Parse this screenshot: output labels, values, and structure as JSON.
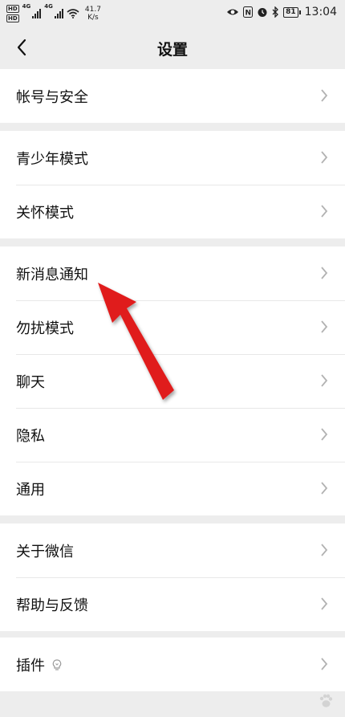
{
  "status_bar": {
    "sim1_label": "HD",
    "sim2_label": "HD",
    "net_type_1": "4G",
    "net_type_2": "4G",
    "speed_value": "41.7",
    "speed_unit": "K/s",
    "battery_level": "81",
    "time": "13:04",
    "icons": [
      "eye-icon",
      "nfc-icon",
      "alarm-icon",
      "bluetooth-icon",
      "battery-icon"
    ]
  },
  "nav": {
    "title": "设置",
    "back_icon": "chevron-left-icon"
  },
  "groups": [
    {
      "items": [
        {
          "label": "帐号与安全"
        }
      ]
    },
    {
      "items": [
        {
          "label": "青少年模式"
        },
        {
          "label": "关怀模式"
        }
      ]
    },
    {
      "items": [
        {
          "label": "新消息通知"
        },
        {
          "label": "勿扰模式"
        },
        {
          "label": "聊天"
        },
        {
          "label": "隐私"
        },
        {
          "label": "通用"
        }
      ]
    },
    {
      "items": [
        {
          "label": "关于微信"
        },
        {
          "label": "帮助与反馈"
        }
      ]
    },
    {
      "items": [
        {
          "label": "插件",
          "icon": "plugin-icon"
        }
      ]
    }
  ],
  "colors": {
    "background": "#ededed",
    "row_background": "#ffffff",
    "chevron": "#b2b2b2",
    "annotation_arrow": "#e01b1b"
  }
}
